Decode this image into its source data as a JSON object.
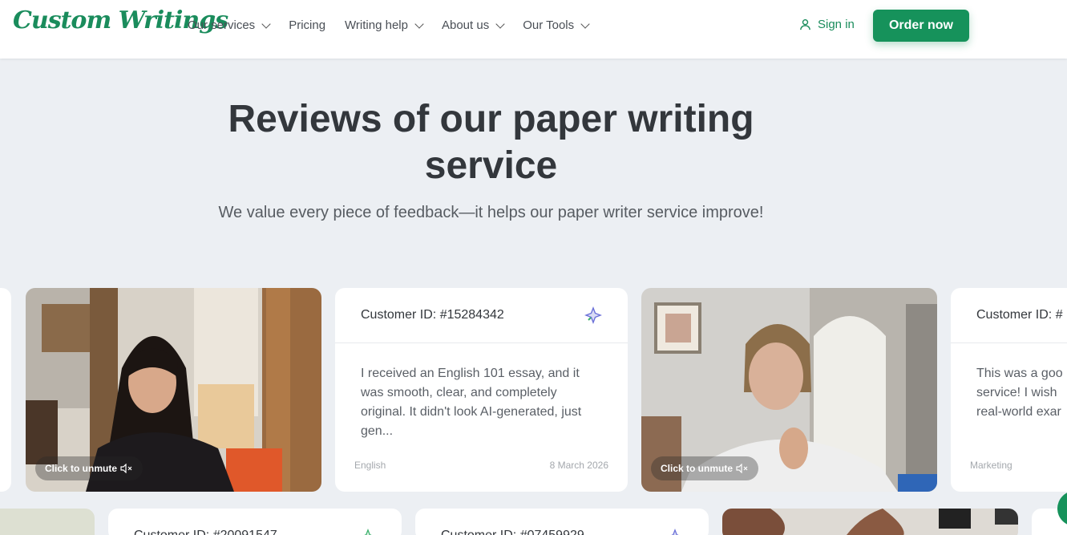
{
  "header": {
    "logo": "Custom Writings",
    "nav": [
      {
        "label": "Our services",
        "has_dropdown": true
      },
      {
        "label": "Pricing",
        "has_dropdown": false
      },
      {
        "label": "Writing help",
        "has_dropdown": true
      },
      {
        "label": "About us",
        "has_dropdown": true
      },
      {
        "label": "Our Tools",
        "has_dropdown": true
      }
    ],
    "sign_in": "Sign in",
    "order_now": "Order now"
  },
  "hero": {
    "title": "Reviews of our paper writing service",
    "subtitle": "We value every piece of feedback—it helps our paper writer service improve!"
  },
  "reviews_row1": [
    {
      "type": "video",
      "unmute_label": "Click to unmute"
    },
    {
      "type": "text",
      "customer_id": "Customer ID: #15284342",
      "text": "I received an English 101 essay, and it was smooth, clear, and completely original. It didn't look AI-generated, just gen...",
      "subject": "English",
      "date": "8 March 2026"
    },
    {
      "type": "video",
      "unmute_label": "Click to unmute"
    },
    {
      "type": "text",
      "customer_id": "Customer ID: #",
      "text": "This was a goo service! I wish real-world exar",
      "subject": "Marketing",
      "date": ""
    }
  ],
  "reviews_row2": [
    {
      "customer_id": "Customer ID: #20091547"
    },
    {
      "customer_id": "Customer ID: #07459929"
    }
  ],
  "colors": {
    "brand_green": "#16925b",
    "background": "#eceff3",
    "card": "#ffffff"
  }
}
